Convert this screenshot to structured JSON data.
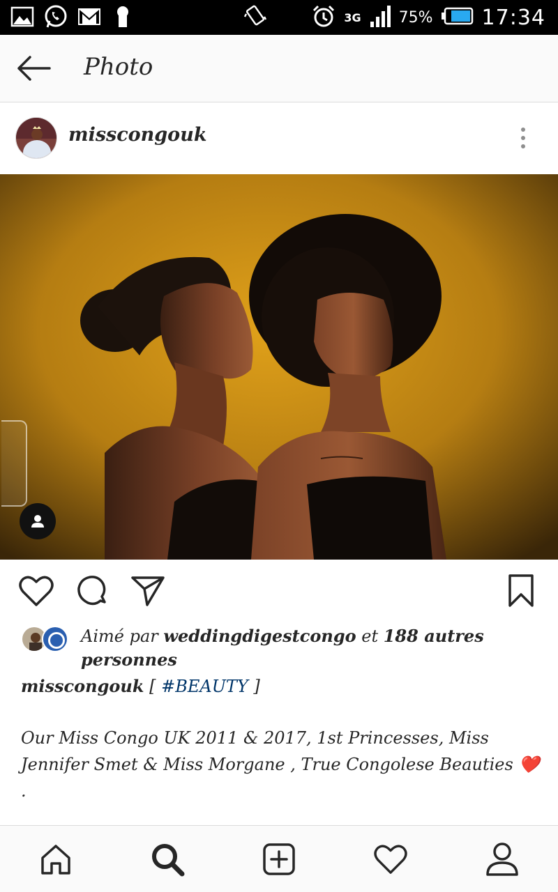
{
  "status_bar": {
    "network": "3G",
    "battery_percent": "75%",
    "time": "17:34",
    "icons": [
      "gallery-icon",
      "whatsapp-icon",
      "gmail-icon",
      "keyhole-icon",
      "vibrate-icon",
      "alarm-icon",
      "signal-icon",
      "battery-icon"
    ]
  },
  "app_bar": {
    "title": "Photo"
  },
  "post": {
    "username": "misscongouk",
    "likes": {
      "prefix": "Aimé par ",
      "liker": "weddingdigestcongo",
      "middle": " et ",
      "count_text": "188 autres",
      "suffix": " personnes"
    },
    "caption": {
      "username": "misscongouk",
      "open": " [ ",
      "hashtag": "#BEAUTY",
      "close": " ]",
      "body": "Our Miss Congo UK 2011 & 2017, 1st Princesses, Miss Jennifer Smet & Miss Morgane , True Congolese Beauties ❤️",
      "body_tail": ".",
      "divider": "______________________"
    }
  },
  "colors": {
    "hashtag": "#003569",
    "photo_backdrop": "#c98a12",
    "text": "#262626"
  }
}
